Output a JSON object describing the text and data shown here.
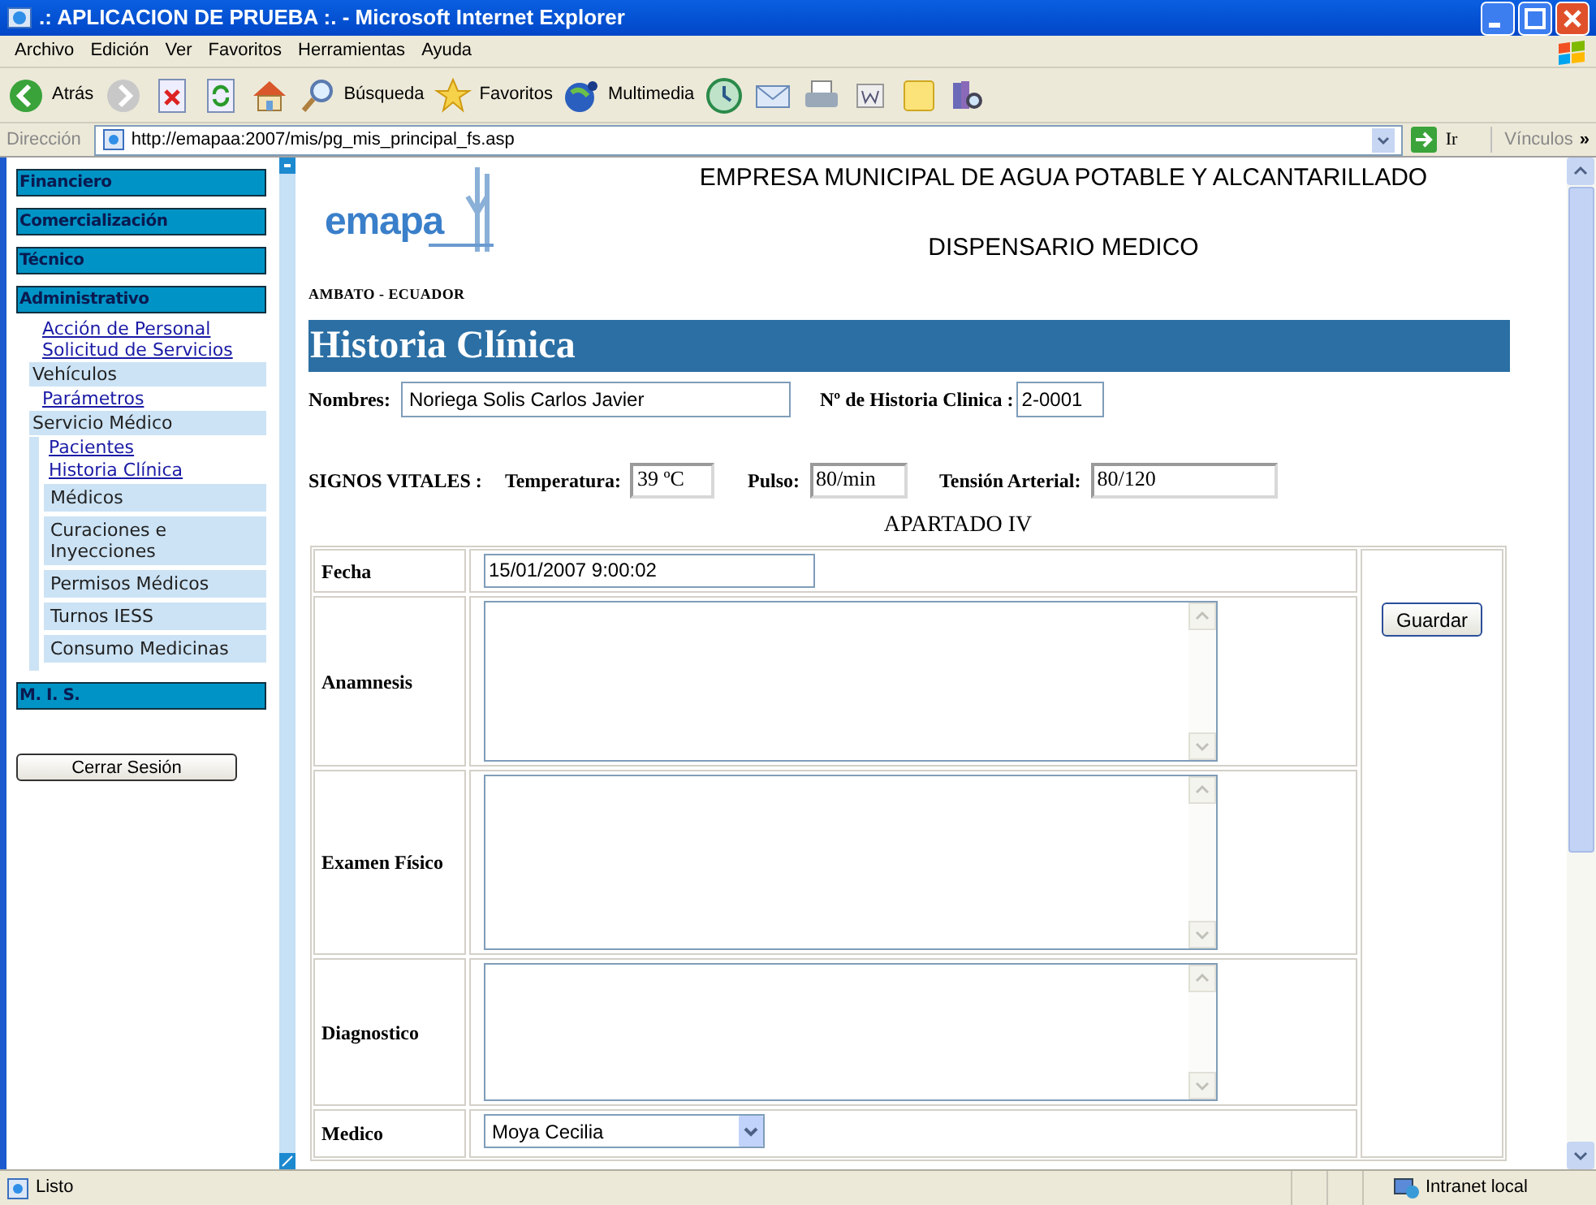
{
  "window": {
    "title": ".: APLICACION DE PRUEBA :. - Microsoft Internet Explorer"
  },
  "menu": [
    "Archivo",
    "Edición",
    "Ver",
    "Favoritos",
    "Herramientas",
    "Ayuda"
  ],
  "toolbar": [
    {
      "kind": "back",
      "label": "Atrás"
    },
    {
      "kind": "forward"
    },
    {
      "kind": "stop"
    },
    {
      "kind": "refresh"
    },
    {
      "kind": "home"
    },
    {
      "kind": "search",
      "label": "Búsqueda"
    },
    {
      "kind": "favorites",
      "label": "Favoritos"
    },
    {
      "kind": "media",
      "label": "Multimedia"
    },
    {
      "kind": "history"
    },
    {
      "kind": "mail"
    },
    {
      "kind": "print"
    },
    {
      "kind": "edit"
    },
    {
      "kind": "note"
    },
    {
      "kind": "research"
    }
  ],
  "address_bar": {
    "label": "Dirección",
    "url": "http://emapaa:2007/mis/pg_mis_principal_fs.asp",
    "go": "Ir",
    "links": "Vínculos",
    "more": "»"
  },
  "sidebar": {
    "items": [
      {
        "kind": "header",
        "label": "Financiero"
      },
      {
        "kind": "header",
        "label": "Comercialización"
      },
      {
        "kind": "header",
        "label": "Técnico"
      },
      {
        "kind": "header",
        "label": "Administrativo",
        "children": [
          {
            "kind": "link",
            "label": "Acción de Personal"
          },
          {
            "kind": "link",
            "label": "Solicitud de Servicios"
          },
          {
            "kind": "folder",
            "label": "Vehículos"
          },
          {
            "kind": "link",
            "label": "Parámetros"
          },
          {
            "kind": "folder",
            "label": "Servicio Médico",
            "children": [
              {
                "kind": "link",
                "label": "Pacientes"
              },
              {
                "kind": "link",
                "label": "Historia Clínica"
              },
              {
                "kind": "folder",
                "label": "Médicos"
              },
              {
                "kind": "folder",
                "label": "Curaciones e Inyecciones"
              },
              {
                "kind": "folder",
                "label": "Permisos Médicos"
              },
              {
                "kind": "folder",
                "label": "Turnos IESS"
              },
              {
                "kind": "folder",
                "label": "Consumo Medicinas"
              }
            ]
          }
        ]
      },
      {
        "kind": "header",
        "label": "M. I. S."
      }
    ],
    "button": "Cerrar Sesión"
  },
  "page": {
    "logo": "emapa",
    "logo_caption": "AMBATO - ECUADOR",
    "company": "EMPRESA MUNICIPAL DE AGUA POTABLE Y ALCANTARILLADO",
    "department": "DISPENSARIO MEDICO",
    "banner": "Historia Clínica",
    "patient": {
      "name_label": "Nombres:",
      "name": "Noriega Solis Carlos Javier",
      "record_label": "Nº de Historia Clinica :",
      "record": "2-0001"
    },
    "vitals": {
      "label": "SIGNOS VITALES :",
      "items": [
        {
          "label": "Temperatura:",
          "value": "39 ºC"
        },
        {
          "label": "Pulso:",
          "value": "80/min"
        },
        {
          "label": "Tensión Arterial:",
          "value": "80/120"
        }
      ]
    },
    "section": "APARTADO IV",
    "form": [
      {
        "kind": "input",
        "label": "Fecha",
        "value": "15/01/2007 9:00:02"
      },
      {
        "kind": "textarea",
        "label": "Anamnesis"
      },
      {
        "kind": "textarea",
        "label": "Examen Físico"
      },
      {
        "kind": "textarea",
        "label": "Diagnostico"
      },
      {
        "kind": "select",
        "label": "Medico",
        "value": "Moya Cecilia"
      }
    ],
    "save": "Guardar"
  },
  "status_bar": {
    "text": "Listo",
    "zone": "Intranet local"
  }
}
